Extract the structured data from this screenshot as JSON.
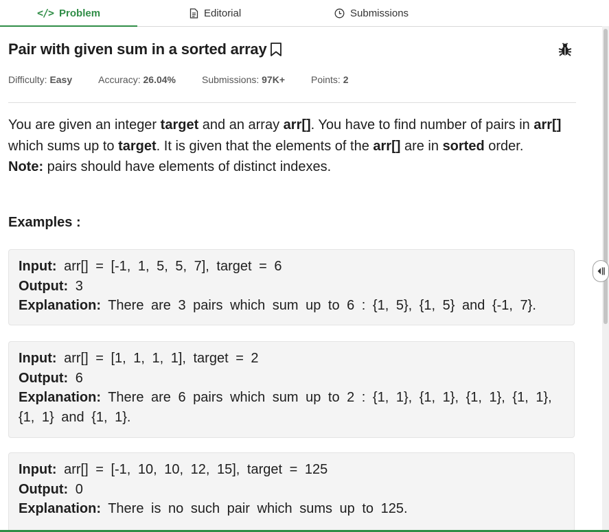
{
  "tabs": [
    {
      "label": "Problem",
      "icon": "code-icon"
    },
    {
      "label": "Editorial",
      "icon": "document-icon"
    },
    {
      "label": "Submissions",
      "icon": "clock-icon"
    }
  ],
  "problem": {
    "title": "Pair with given sum in a sorted array",
    "meta": [
      {
        "label": "Difficulty:",
        "value": "Easy"
      },
      {
        "label": "Accuracy:",
        "value": "26.04%"
      },
      {
        "label": "Submissions:",
        "value": "97K+"
      },
      {
        "label": "Points:",
        "value": "2"
      }
    ]
  },
  "description": {
    "s1": "You are given an integer ",
    "b1": "target",
    "s2": " and an array ",
    "b2": "arr[]",
    "s3": ". You have to find number of pairs in ",
    "b3": "arr[]",
    "s4": " which sums up to ",
    "b4": "target",
    "s5": ". It is given that the elements of the ",
    "b5": "arr[]",
    "s6": " are in ",
    "b6": "sorted",
    "s7": " order.",
    "note_label": "Note:",
    "note_text": " pairs should have elements of distinct indexes."
  },
  "examples_heading": "Examples :",
  "examples": [
    {
      "input_label": "Input:",
      "input": " arr[] = [-1, 1, 5, 5, 7], target = 6",
      "output_label": "Output:",
      "output": " 3",
      "explanation_label": "Explanation:",
      "explanation": " There are 3 pairs which sum up to 6 : {1, 5}, {1, 5} and {-1, 7}."
    },
    {
      "input_label": "Input:",
      "input": " arr[] = [1, 1, 1, 1], target = 2",
      "output_label": "Output:",
      "output": " 6",
      "explanation_label": "Explanation:",
      "explanation": " There are 6 pairs which sum up to 2 : {1, 1}, {1, 1}, {1, 1}, {1, 1}, {1, 1} and {1, 1}."
    },
    {
      "input_label": "Input:",
      "input": " arr[] = [-1, 10, 10, 12, 15], target = 125",
      "output_label": "Output:",
      "output": " 0",
      "explanation_label": "Explanation:",
      "explanation": " There is no such pair which sums up to 125."
    }
  ],
  "colors": {
    "accent": "#2f8d46",
    "example_bg": "#f4f4f4",
    "text": "#1e1e1e"
  },
  "icons": [
    "code-icon",
    "document-icon",
    "clock-icon",
    "bookmark-icon",
    "bug-icon",
    "panel-resize-icon"
  ]
}
